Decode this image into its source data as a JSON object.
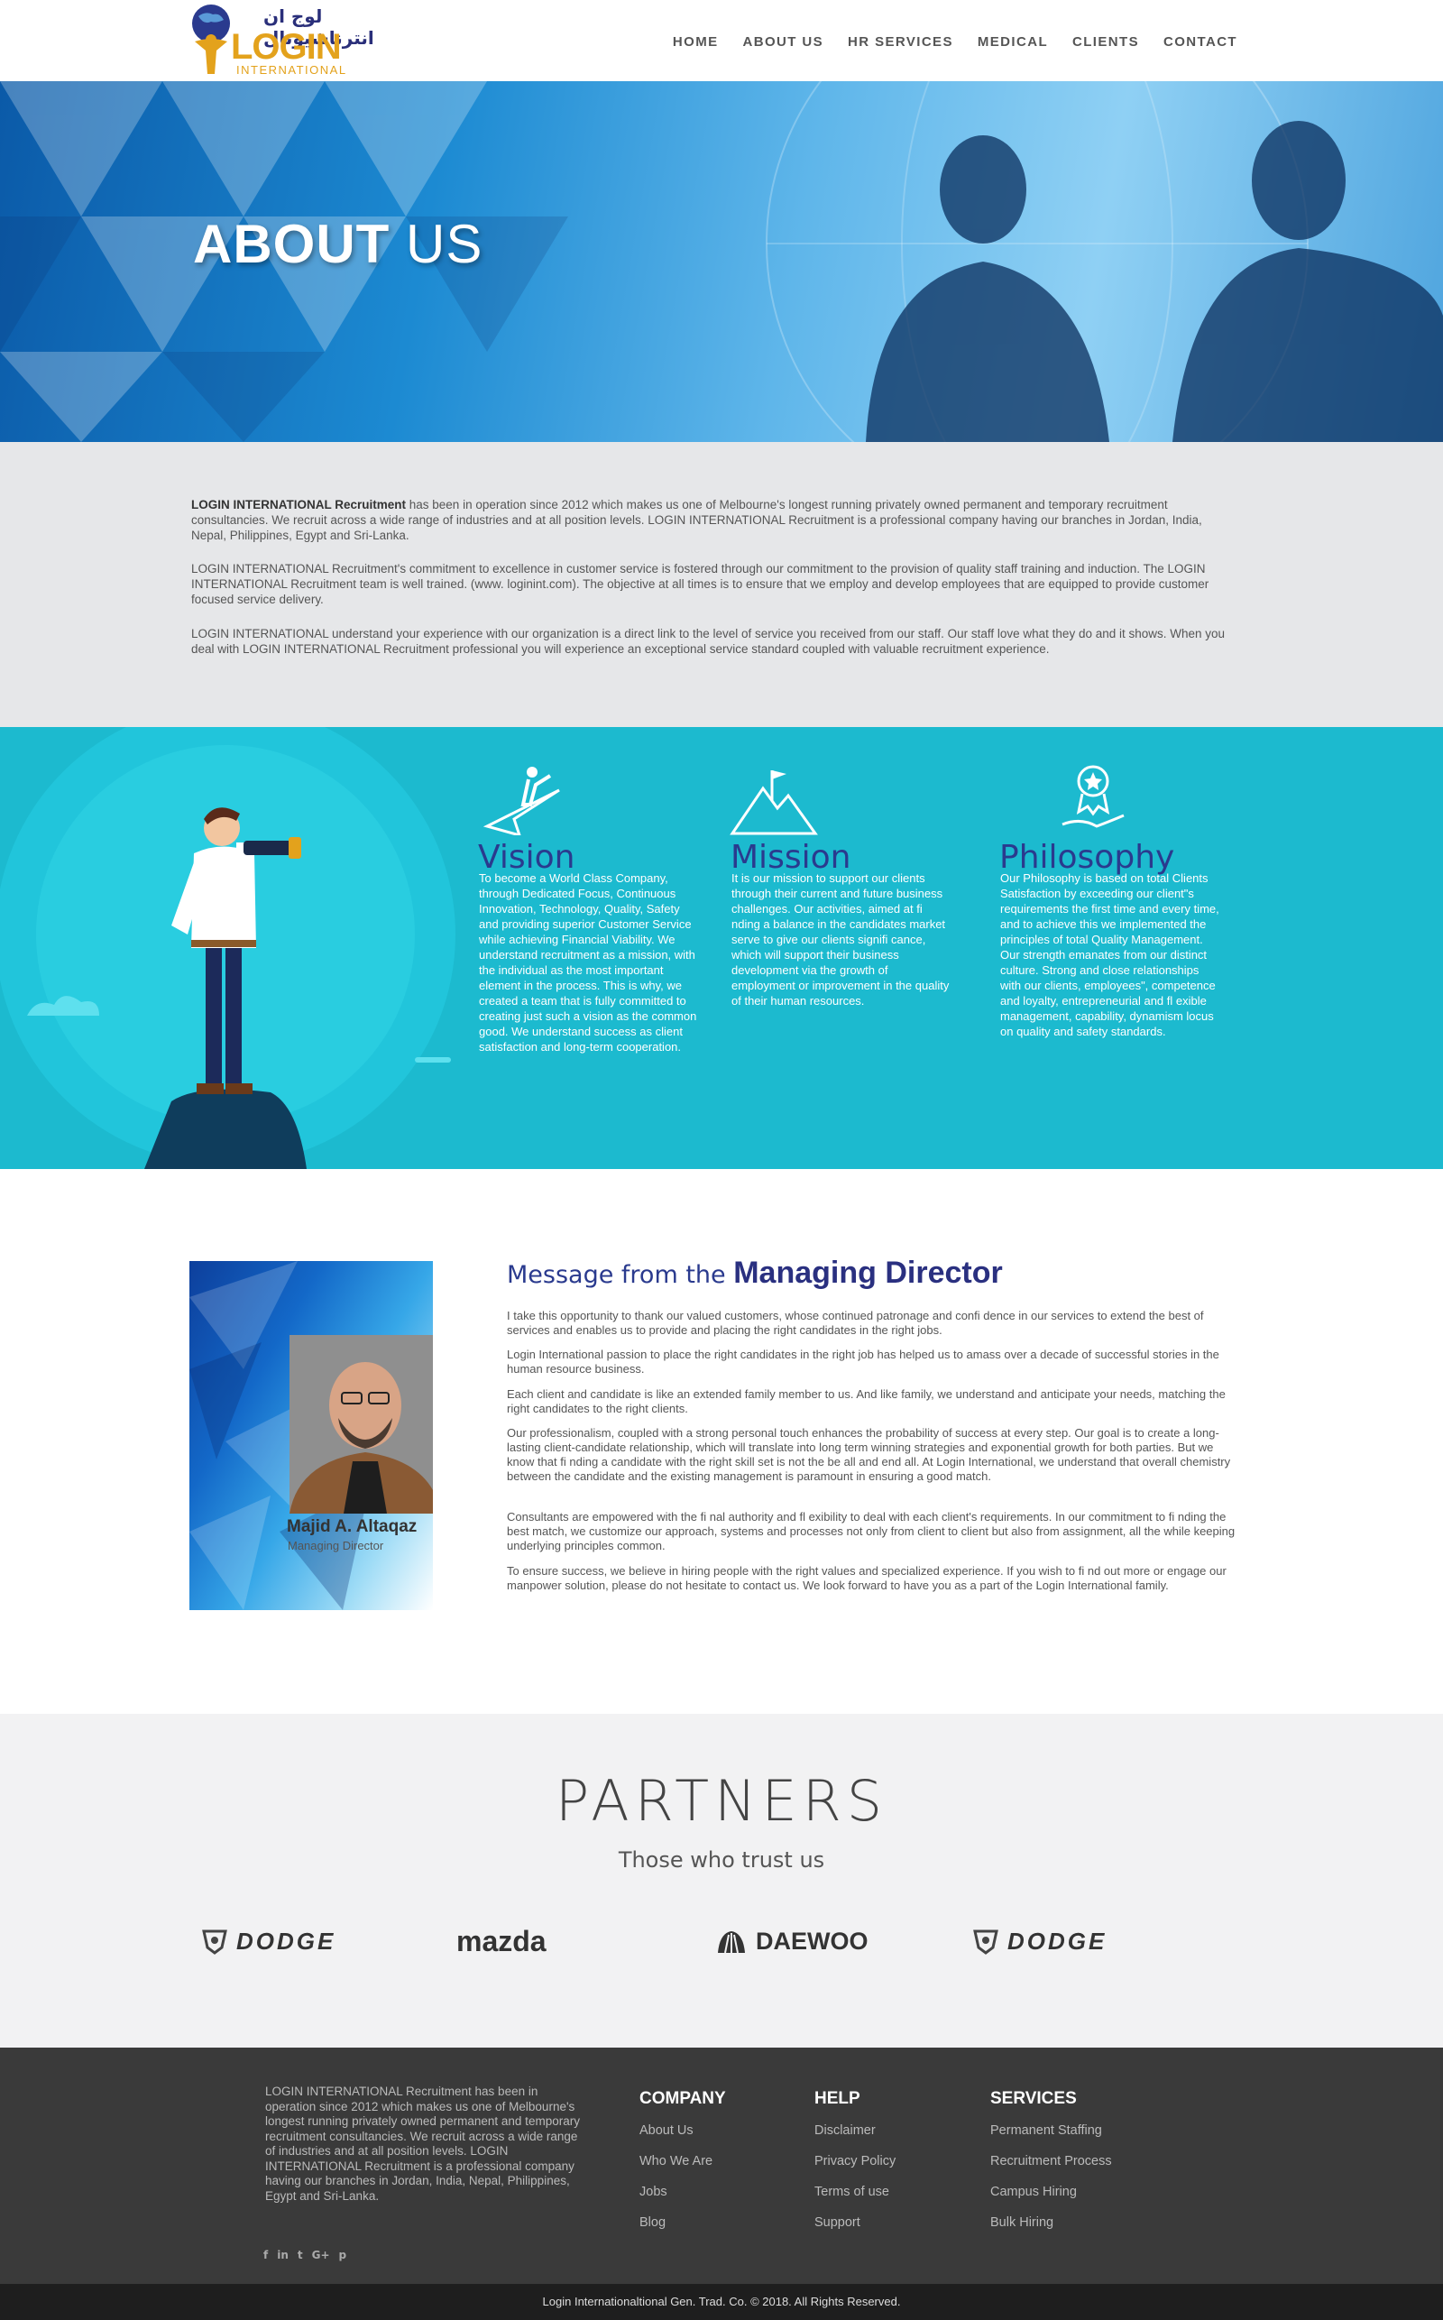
{
  "header": {
    "logo_arabic": "لوج ان انترناشيونال",
    "logo_word": "LOGIN",
    "logo_sub": "INTERNATIONAL",
    "nav": [
      "HOME",
      "ABOUT US",
      "HR SERVICES",
      "MEDICAL",
      "CLIENTS",
      "CONTACT"
    ]
  },
  "hero": {
    "title_bold": "ABOUT",
    "title_light": "US"
  },
  "intro": {
    "p1_bold": "LOGIN INTERNATIONAL Recruitment",
    "p1": " has been in operation since 2012 which makes us one of Melbourne's longest running privately owned permanent and temporary recruitment consultancies. We recruit across a wide range of industries and at all position levels. LOGIN INTERNATIONAL Recruitment is a professional company having our branches in Jordan, India, Nepal, Philippines, Egypt and Sri-Lanka.",
    "p2": "LOGIN INTERNATIONAL Recruitment's commitment to excellence in customer service is fostered through our commitment to the provision of quality staff training and induction. The LOGIN INTERNATIONAL Recruitment team is well trained. (www. loginint.com). The objective at all times is to ensure that we employ and develop employees that are equipped to provide customer focused service delivery.",
    "p3": "LOGIN INTERNATIONAL understand your experience with our organization is a direct link to the level of service you received from our staff. Our staff love what they do and it shows. When you deal with LOGIN INTERNATIONAL Recruitment professional you will experience an exceptional service standard coupled with valuable recruitment experience."
  },
  "values": {
    "vision": {
      "title": "Vision",
      "text": "To become a World Class Company, through Dedicated Focus, Continuous Innovation, Technology, Quality, Safety and providing superior Customer Service while achieving Financial Viability. We understand recruitment as a mission, with the individual as the most important element in the process. This is why, we created a team that is fully committed to creating just such a vision as the common good. We understand success as client satisfaction and long-term cooperation."
    },
    "mission": {
      "title": "Mission",
      "text": "It is our mission to support our clients through their current and future business challenges. Our activities, aimed at fi nding a balance in the candidates market serve to give our clients signifi cance, which will support their business development via the growth of employment or improvement in the quality of their human resources."
    },
    "philosophy": {
      "title": "Philosophy",
      "text": "Our Philosophy is based on total Clients Satisfaction by exceeding our client\"s requirements the first time and every time, and to achieve this we implemented the principles of total Quality Management. Our strength emanates from our distinct culture. Strong and close relationships with our clients, employees\", competence and loyalty, entrepreneurial and fl exible management, capability, dynamism locus on quality and safety standards."
    }
  },
  "director": {
    "heading_light": "Message from the ",
    "heading_bold": "Managing Director",
    "name": "Majid A. Altaqaz",
    "role": "Managing Director",
    "paragraphs": [
      "I take this opportunity to thank our valued customers, whose continued patronage and confi dence in our services to extend the best of services and enables us to provide and placing the right candidates in the right jobs.",
      "Login International passion to place the right candidates in the right job has helped us to amass over a decade of successful stories in the human resource business.",
      "Each client and candidate is like an extended family member to us. And like family, we understand and anticipate your needs, matching the right candidates to the right clients.",
      "Our professionalism, coupled with a strong personal touch enhances the probability of success at every step. Our goal is to create a long-lasting client-candidate relationship, which will translate into long term winning strategies and exponential growth for both parties. But we know that fi nding a candidate with the right skill set is not the be all and end all. At Login International, we understand that overall chemistry between the candidate and the existing management is paramount in ensuring a good match.",
      "Consultants are empowered with the fi nal authority and fl exibility to deal with each client's requirements. In our commitment to fi nding the best match, we customize our approach, systems and processes not only from client to client but also from assignment, all the while keeping underlying principles common.",
      "To ensure success, we believe in hiring people with the right values and specialized experience. If you wish to fi nd out more or engage our manpower solution, please do not hesitate to contact us. We look forward to have you as a part of the Login International family."
    ]
  },
  "partners": {
    "title": "PARTNERS",
    "subtitle": "Those who trust us",
    "logos": [
      "DODGE",
      "mazda",
      "DAEWOO",
      "DODGE"
    ]
  },
  "footer": {
    "about": "LOGIN INTERNATIONAL Recruitment has been in operation since 2012 which makes us one of Melbourne's longest running privately owned permanent and temporary recruitment consultancies. We recruit across a wide range of industries and at all position levels. LOGIN INTERNATIONAL Recruitment is a professional company having our branches in Jordan, India, Nepal, Philippines, Egypt and Sri-Lanka.",
    "social": [
      "f",
      "in",
      "t",
      "G+",
      "p"
    ],
    "company": {
      "title": "COMPANY",
      "links": [
        "About Us",
        "Who We Are",
        "Jobs",
        "Blog"
      ]
    },
    "help": {
      "title": "HELP",
      "links": [
        "Disclaimer",
        "Privacy Policy",
        "Terms of use",
        "Support"
      ]
    },
    "services": {
      "title": "SERVICES",
      "links": [
        "Permanent Staffing",
        "Recruitment Process",
        "Campus Hiring",
        "Bulk Hiring"
      ]
    },
    "copyright": "Login Internationaltional Gen. Trad. Co. © 2018. All Rights Reserved."
  }
}
